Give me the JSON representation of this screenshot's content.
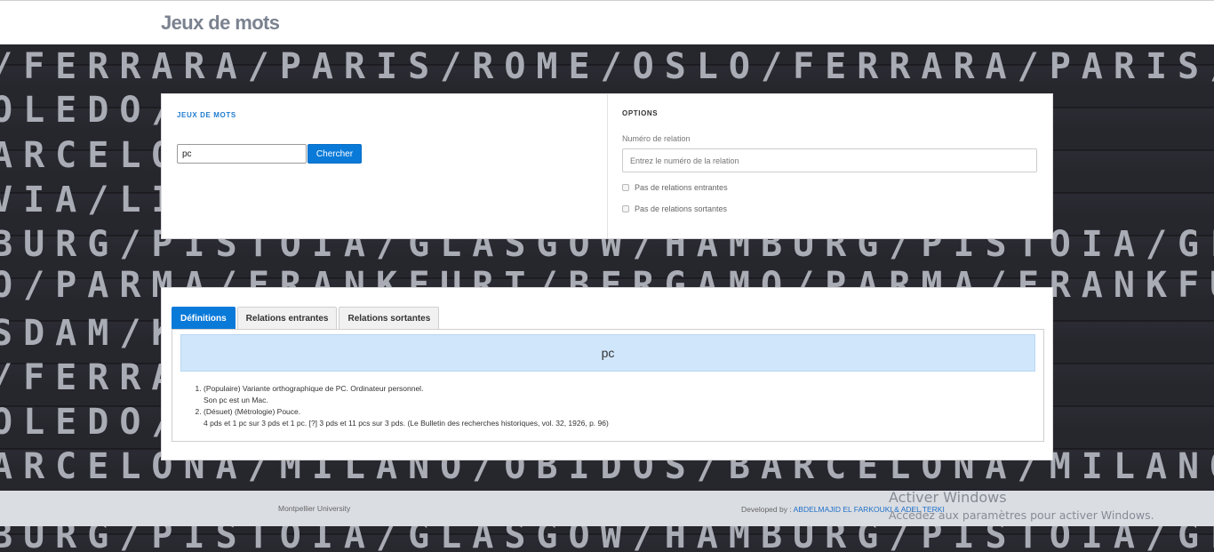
{
  "header": {
    "title": "Jeux de mots"
  },
  "background_board": {
    "rows": [
      "/FERRARA/PARIS/ROME/OSLO/FERRARA/PARIS/RO",
      "OLEDO/C.../AMSTERDAM/K",
      "ARCELO...MILANO/O",
      "VIA/LI...BUDAPES",
      "BURG/PISTOIA/GLASGOW/HAMBURG/PISTOIA/GLAS",
      "O/PARMA/FRANKFURT/BERGAMO/PARMA/FRANKFURT",
      "SDAM/K...S/DUB",
      "/FERRA...IS/RO",
      "OLEDO/...DAM/KA",
      "ARCELONA/MILANO/OBIDOS/BARCELONA/MILANO/OB",
      "BURG/PISTOIA/GLASGOW/HAMBURG/PISTOIA/GLAS"
    ]
  },
  "search": {
    "section_title": "JEUX DE MOTS",
    "input_value": "pc",
    "button_label": "Chercher"
  },
  "options": {
    "section_title": "OPTIONS",
    "relation_label": "Numéro de relation",
    "relation_placeholder": "Entrez le numéro de la relation",
    "checkbox_incoming": "Pas de relations entrantes",
    "checkbox_outgoing": "Pas de relations sortantes"
  },
  "results": {
    "tabs": [
      {
        "label": "Définitions",
        "active": true
      },
      {
        "label": "Relations entrantes",
        "active": false
      },
      {
        "label": "Relations sortantes",
        "active": false
      }
    ],
    "word": "pc",
    "definitions": [
      {
        "text": "(Populaire) Variante orthographique de PC. Ordinateur personnel.",
        "example": "Son pc est un Mac."
      },
      {
        "text": "(Désuet) (Métrologie) Pouce.",
        "example": "4 pds et 1 pc sur 3 pds et 1 pc. [?] 3 pds et 11 pcs sur 3 pds. (Le Bulletin des recherches historiques, vol. 32, 1926, p. 96)"
      }
    ]
  },
  "footer": {
    "left_text": "Montpellier University",
    "developed_by": "Developed by :",
    "authors": "ABDELMAJID EL FARKOUKI & ADEL TERKI"
  },
  "watermark": {
    "line1": "Activer Windows",
    "line2": "Accédez aux paramètres pour activer Windows."
  },
  "colors": {
    "accent": "#0a7ad9",
    "banner": "#d0e6fb",
    "footer_bg": "#dadde2"
  }
}
